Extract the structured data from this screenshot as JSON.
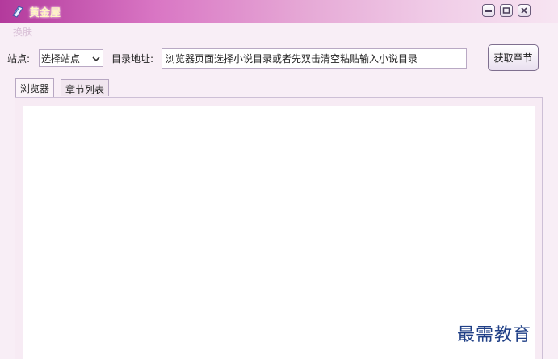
{
  "window": {
    "title": "黄金屋"
  },
  "menu": {
    "items": [
      "换肤"
    ]
  },
  "toolbar": {
    "site_label": "站点:",
    "site_select_value": "选择站点",
    "dir_label": "目录地址:",
    "dir_input_value": "浏览器页面选择小说目录或者先双击清空粘贴输入小说目录",
    "fetch_button": "获取章节"
  },
  "tabs": [
    {
      "label": "浏览器",
      "active": true
    },
    {
      "label": "章节列表",
      "active": false
    }
  ],
  "watermark": "最需教育",
  "icons": [
    "book-icon",
    "minimize-icon",
    "restore-icon",
    "close-icon",
    "chevron-down-icon"
  ]
}
